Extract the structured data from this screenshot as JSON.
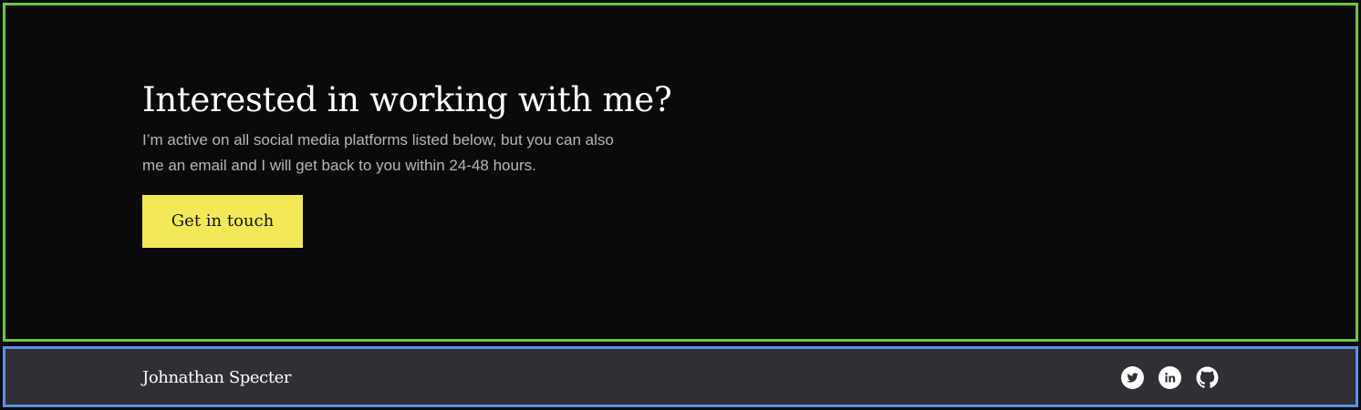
{
  "cta": {
    "title": "Interested in working with me?",
    "description": "I’m active on all social media platforms listed below, but you can also me an email and I will get back to you within 24-48 hours.",
    "button_label": "Get in touch"
  },
  "footer": {
    "name": "Johnathan Specter",
    "social": [
      {
        "icon": "twitter-icon"
      },
      {
        "icon": "linkedin-icon"
      },
      {
        "icon": "github-icon"
      }
    ]
  },
  "colors": {
    "background": "#0a0a0a",
    "footer_background": "#2f2f35",
    "accent": "#f3e958",
    "text_primary": "#ffffff",
    "text_secondary": "#b6b6b8"
  }
}
